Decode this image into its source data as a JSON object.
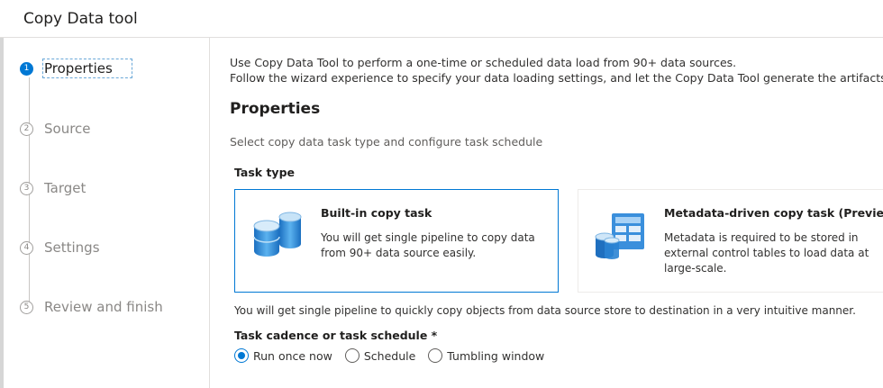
{
  "header": {
    "title": "Copy Data tool"
  },
  "steps": [
    {
      "number": "1",
      "label": "Properties",
      "active": true
    },
    {
      "number": "2",
      "label": "Source",
      "active": false
    },
    {
      "number": "3",
      "label": "Target",
      "active": false
    },
    {
      "number": "4",
      "label": "Settings",
      "active": false
    },
    {
      "number": "5",
      "label": "Review and finish",
      "active": false
    }
  ],
  "main": {
    "intro_line1": "Use Copy Data Tool to perform a one-time or scheduled data load from 90+ data sources.",
    "intro_line2": "Follow the wizard experience to specify your data loading settings, and let the Copy Data Tool generate the artifacts for you, inc",
    "section_title": "Properties",
    "subtitle": "Select copy data task type and configure task schedule",
    "task_type_label": "Task type",
    "cards": [
      {
        "title": "Built-in copy task",
        "description": "You will get single pipeline to copy data from 90+ data source easily.",
        "icon": "database-cylinders-icon",
        "selected": true
      },
      {
        "title": "Metadata-driven copy task (Preview)",
        "description": "Metadata is required to be stored in external control tables to load data at large-scale.",
        "icon": "metadata-table-icon",
        "selected": false
      }
    ],
    "bottom_note": "You will get single pipeline to quickly copy objects from data source store to destination in a very intuitive manner.",
    "cadence_label": "Task cadence or task schedule *",
    "cadence_options": [
      {
        "label": "Run once now",
        "checked": true
      },
      {
        "label": "Schedule",
        "checked": false
      },
      {
        "label": "Tumbling window",
        "checked": false
      }
    ]
  },
  "colors": {
    "accent": "#0078d4",
    "border": "#e1dfdd",
    "muted_text": "#8a8886"
  }
}
